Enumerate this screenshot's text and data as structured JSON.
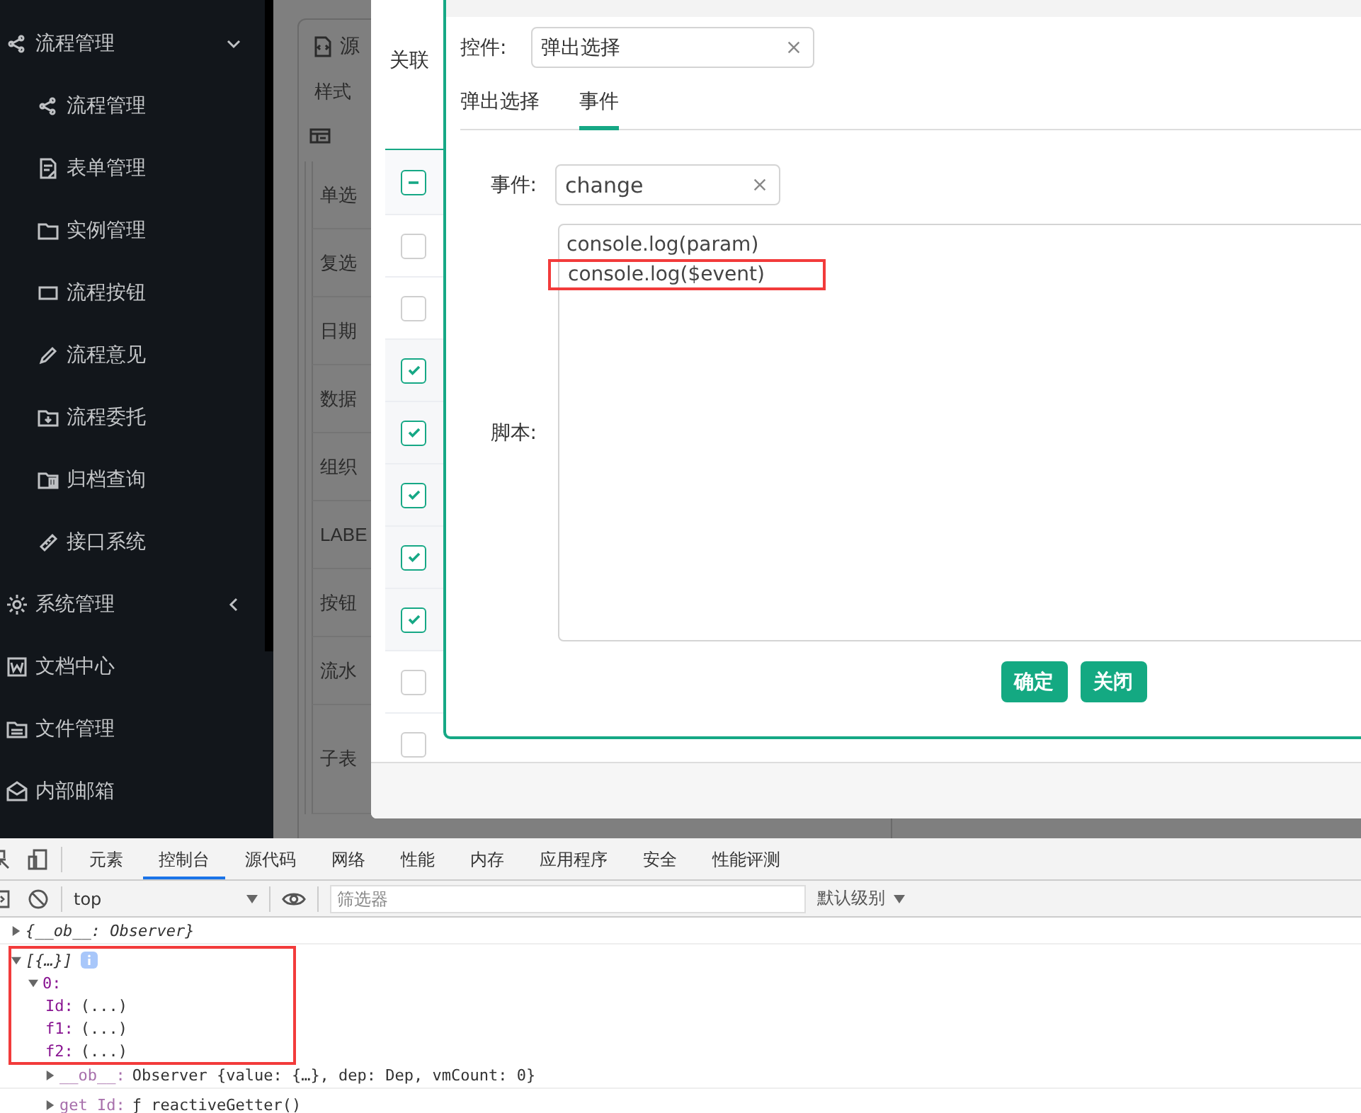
{
  "sidebar": {
    "items": [
      {
        "label": "流程管理",
        "expanded": true,
        "children": [
          {
            "label": "流程管理"
          },
          {
            "label": "表单管理"
          },
          {
            "label": "实例管理"
          },
          {
            "label": "流程按钮"
          },
          {
            "label": "流程意见"
          },
          {
            "label": "流程委托"
          },
          {
            "label": "归档查询"
          },
          {
            "label": "接口系统"
          }
        ]
      },
      {
        "label": "系统管理",
        "expanded": false
      },
      {
        "label": "文档中心"
      },
      {
        "label": "文件管理"
      },
      {
        "label": "内部邮箱"
      }
    ]
  },
  "background_page": {
    "tab": "源",
    "section": "样式",
    "rows": [
      "单选",
      "复选",
      "日期",
      "数据",
      "组织",
      "LABE",
      "按钮",
      "流水",
      "子表"
    ]
  },
  "modal": {
    "label": "关联",
    "header_checkbox": {
      "indeterminate": true
    },
    "rows": [
      {
        "checked": false
      },
      {
        "checked": false
      },
      {
        "checked": true
      },
      {
        "checked": true
      },
      {
        "checked": true
      },
      {
        "checked": true
      },
      {
        "checked": true
      },
      {
        "checked": false
      },
      {
        "checked": false
      }
    ]
  },
  "dialog": {
    "control_label": "控件:",
    "control_value": "弹出选择",
    "tabs": [
      {
        "label": "弹出选择",
        "selected": false
      },
      {
        "label": "事件",
        "selected": true
      }
    ],
    "event_label": "事件:",
    "event_value": "change",
    "script_label": "脚本:",
    "script_lines": [
      {
        "text": "console.log(param)",
        "highlighted": false
      },
      {
        "text": "console.log($event)",
        "highlighted": true
      }
    ],
    "buttons": [
      "确定",
      "关闭"
    ]
  },
  "devtools": {
    "tabs": [
      {
        "label": "元素",
        "selected": false
      },
      {
        "label": "控制台",
        "selected": true
      },
      {
        "label": "源代码",
        "selected": false
      },
      {
        "label": "网络",
        "selected": false
      },
      {
        "label": "性能",
        "selected": false
      },
      {
        "label": "内存",
        "selected": false
      },
      {
        "label": "应用程序",
        "selected": false
      },
      {
        "label": "安全",
        "selected": false
      },
      {
        "label": "性能评测",
        "selected": false
      }
    ],
    "context": "top",
    "filter": {
      "placeholder": "筛选器"
    },
    "log_level": "默认级别",
    "console": [
      {
        "text": "{__ob__: Observer}",
        "expanded": false,
        "highlighted": false
      },
      {
        "text": "[{…}]",
        "expanded": true,
        "info": true,
        "highlighted": true,
        "children": [
          {
            "key": "0:",
            "expanded": true,
            "highlighted": true,
            "children": [
              {
                "key": "Id:",
                "value": "(...)",
                "highlighted": true
              },
              {
                "key": "f1:",
                "value": "(...)",
                "highlighted": true
              },
              {
                "key": "f2:",
                "value": "(...)",
                "highlighted": true
              },
              {
                "key": "__ob__:",
                "value": "Observer {value: {…}, dep: Dep, vmCount: 0}",
                "expanded": false,
                "highlighted": false
              },
              {
                "key": "get Id:",
                "value": "ƒ reactiveGetter()",
                "expanded": false,
                "highlighted": false
              }
            ]
          }
        ]
      }
    ]
  }
}
